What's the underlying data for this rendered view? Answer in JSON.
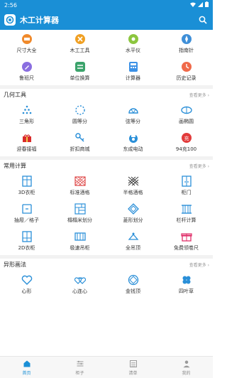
{
  "status": {
    "time": "2:56"
  },
  "app": {
    "title": "木工计算器"
  },
  "top_grid": [
    {
      "label": "尺寸大全",
      "icon": "ruler-icon",
      "color": "#f08a2c"
    },
    {
      "label": "木工工具",
      "icon": "tools-icon",
      "color": "#f0a023"
    },
    {
      "label": "水平仪",
      "icon": "level-icon",
      "color": "#8cc63f"
    },
    {
      "label": "指南针",
      "icon": "compass-icon",
      "color": "#3f8fd8"
    },
    {
      "label": "鲁班尺",
      "icon": "pencil-icon",
      "color": "#8a6ee0"
    },
    {
      "label": "单位换算",
      "icon": "convert-icon",
      "color": "#3ba36b"
    },
    {
      "label": "计算器",
      "icon": "calculator-icon",
      "color": "#3c91e6"
    },
    {
      "label": "历史记录",
      "icon": "history-icon",
      "color": "#f06a4a"
    }
  ],
  "sections": [
    {
      "title": "几何工具",
      "more": "查看更多 ›",
      "items": [
        {
          "label": "三角形",
          "icon": "triangle-icon"
        },
        {
          "label": "圆等分",
          "icon": "circle-divide-icon"
        },
        {
          "label": "弦等分",
          "icon": "chord-divide-icon"
        },
        {
          "label": "画椭圆",
          "icon": "ellipse-icon"
        },
        {
          "label": "迎春接福",
          "icon": "gift-icon"
        },
        {
          "label": "折扣商城",
          "icon": "key-icon"
        },
        {
          "label": "东成电动",
          "icon": "drill-icon"
        },
        {
          "label": "94充100",
          "icon": "recharge-icon"
        }
      ]
    },
    {
      "title": "常用计算",
      "more": "查看更多 ›",
      "items": [
        {
          "label": "3D衣柜",
          "icon": "wardrobe-3d-icon"
        },
        {
          "label": "标准酒格",
          "icon": "wine-grid-icon"
        },
        {
          "label": "半格酒格",
          "icon": "half-wine-grid-icon"
        },
        {
          "label": "柜门",
          "icon": "cabinet-door-icon"
        },
        {
          "label": "抽屉／格子",
          "icon": "drawer-icon"
        },
        {
          "label": "榻榻米划分",
          "icon": "tatami-icon"
        },
        {
          "label": "菱形划分",
          "icon": "diamond-icon"
        },
        {
          "label": "栏杆计算",
          "icon": "railing-icon"
        },
        {
          "label": "2D衣柜",
          "icon": "wardrobe-2d-icon"
        },
        {
          "label": "极速吊柜",
          "icon": "hanging-cabinet-icon"
        },
        {
          "label": "全吊顶",
          "icon": "ceiling-icon"
        },
        {
          "label": "免费领卷尺",
          "icon": "gift-box-icon"
        }
      ]
    },
    {
      "title": "异形画法",
      "more": "查看更多 ›",
      "items": [
        {
          "label": "心形",
          "icon": "heart-icon"
        },
        {
          "label": "心连心",
          "icon": "double-heart-icon"
        },
        {
          "label": "金钱顶",
          "icon": "money-top-icon"
        },
        {
          "label": "四叶草",
          "icon": "clover-icon"
        }
      ]
    }
  ],
  "tabs": [
    {
      "label": "首页",
      "icon": "home-icon",
      "active": true
    },
    {
      "label": "柜子",
      "icon": "sliders-icon",
      "active": false
    },
    {
      "label": "清单",
      "icon": "list-icon",
      "active": false
    },
    {
      "label": "我的",
      "icon": "user-icon",
      "active": false
    }
  ],
  "colors": {
    "primary": "#1a8fd6",
    "icon_blue": "#2a8fd8"
  }
}
